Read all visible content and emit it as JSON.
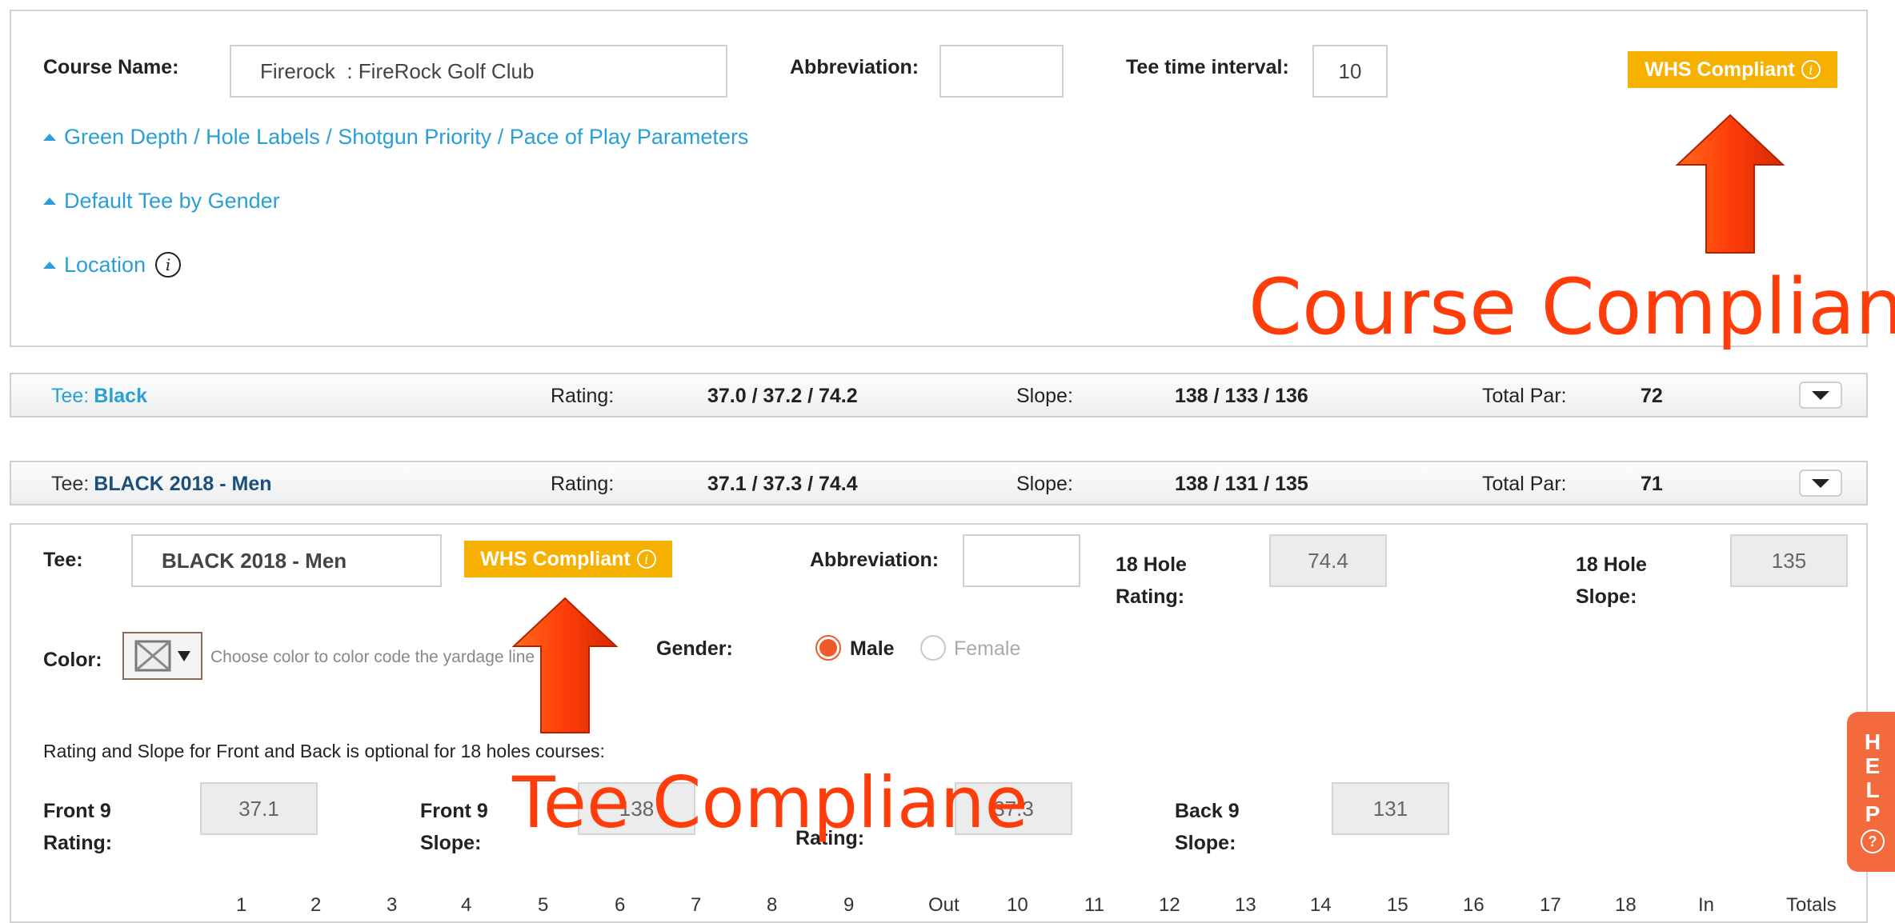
{
  "course": {
    "name_label": "Course Name:",
    "name_value": "Firerock  : FireRock Golf Club",
    "abbr_label": "Abbreviation:",
    "abbr_value": "",
    "interval_label": "Tee time interval:",
    "interval_value": "10",
    "whs_badge": "WHS Compliant",
    "links": [
      "Green Depth / Hole Labels / Shotgun Priority / Pace of Play Parameters",
      "Default Tee by Gender",
      "Location"
    ]
  },
  "tees": [
    {
      "tee_label": "Tee:",
      "name": "Black",
      "rating_label": "Rating:",
      "rating": "37.0 / 37.2 / 74.2",
      "slope_label": "Slope:",
      "slope": "138 / 133 / 136",
      "par_label": "Total Par:",
      "par": "72"
    },
    {
      "tee_label": "Tee:",
      "name": "BLACK 2018 - Men",
      "rating_label": "Rating:",
      "rating": "37.1 / 37.3 / 74.4",
      "slope_label": "Slope:",
      "slope": "138 / 131 / 135",
      "par_label": "Total Par:",
      "par": "71"
    }
  ],
  "tee_detail": {
    "tee_label": "Tee:",
    "tee_value": "BLACK 2018 - Men",
    "whs_badge": "WHS Compliant",
    "abbr_label": "Abbreviation:",
    "abbr_value": "",
    "rating18_label_1": "18 Hole",
    "rating18_label_2": "Rating:",
    "rating18_value": "74.4",
    "slope18_label_1": "18 Hole",
    "slope18_label_2": "Slope:",
    "slope18_value": "135",
    "color_label": "Color:",
    "color_hint": "Choose color to color code the yardage line",
    "gender_label": "Gender:",
    "gender_male": "Male",
    "gender_female": "Female",
    "gender_selected": "Male",
    "optional_note": "Rating and Slope for Front and Back is optional for 18 holes courses:",
    "front9_rating_label_1": "Front 9",
    "front9_rating_label_2": "Rating:",
    "front9_rating_value": "37.1",
    "front9_slope_label_1": "Front 9",
    "front9_slope_label_2": "Slope:",
    "front9_slope_value": "138",
    "back9_rating_label_2": "Rating:",
    "back9_rating_value": "37.3",
    "back9_slope_label_1": "Back 9",
    "back9_slope_label_2": "Slope:",
    "back9_slope_value": "131",
    "hole_headers": [
      "1",
      "2",
      "3",
      "4",
      "5",
      "6",
      "7",
      "8",
      "9",
      "Out",
      "10",
      "11",
      "12",
      "13",
      "14",
      "15",
      "16",
      "17",
      "18",
      "In",
      "Totals"
    ]
  },
  "annotations": {
    "course": "Course Compliane",
    "tee": "Tee Compliane"
  },
  "help": {
    "letters": [
      "H",
      "E",
      "L",
      "P"
    ]
  },
  "colors": {
    "accent_link": "#2a9fd6",
    "whs_badge": "#f5b000",
    "annotation": "#ff3d0a",
    "help_tab": "#f36b3c",
    "radio_selected": "#f05a28"
  }
}
